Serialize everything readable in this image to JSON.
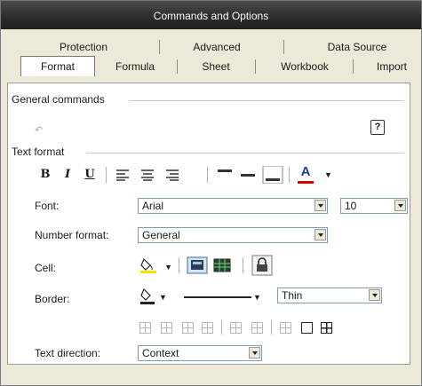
{
  "window": {
    "title": "Commands and Options"
  },
  "tabs": {
    "row1": [
      "Protection",
      "Advanced",
      "Data Source"
    ],
    "row2": [
      "Format",
      "Formula",
      "Sheet",
      "Workbook",
      "Import"
    ],
    "active": "Format"
  },
  "general": {
    "heading": "General commands",
    "help": "?"
  },
  "text_format": {
    "heading": "Text format",
    "bold": "B",
    "italic": "I",
    "underline": "U",
    "font_color_letter": "A"
  },
  "font": {
    "label": "Font:",
    "name": "Arial",
    "size": "10"
  },
  "number_format": {
    "label": "Number format:",
    "value": "General"
  },
  "cell": {
    "label": "Cell:"
  },
  "border": {
    "label": "Border:",
    "weight": "Thin"
  },
  "text_direction": {
    "label": "Text direction:",
    "value": "Context"
  },
  "colors": {
    "title_bar": "#2b2b2b",
    "font_color_bar": "#d40000",
    "fill_color_bar": "#ffe000"
  }
}
